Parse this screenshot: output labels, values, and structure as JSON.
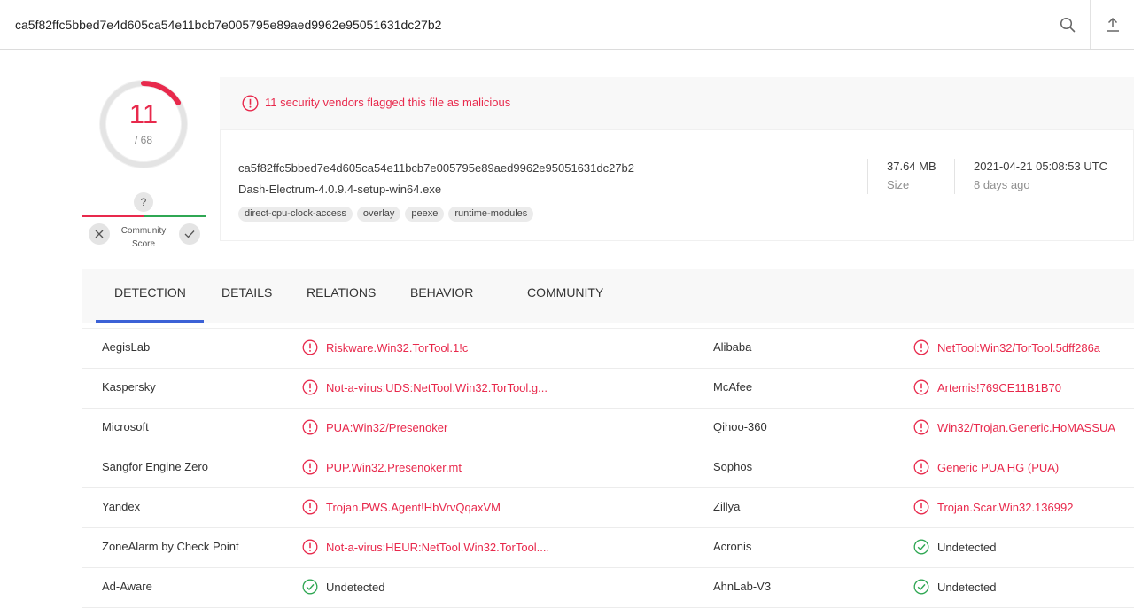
{
  "search": {
    "value": "ca5f82ffc5bbed7e4d605ca54e11bcb7e005795e89aed9962e95051631dc27b2"
  },
  "score": {
    "detections": 11,
    "total_label": "/ 68",
    "detections_text": "11",
    "fraction": 0.1618
  },
  "community": {
    "question": "?",
    "label_line1": "Community",
    "label_line2": "Score"
  },
  "banner": {
    "text": "11 security vendors flagged this file as malicious"
  },
  "file": {
    "hash": "ca5f82ffc5bbed7e4d605ca54e11bcb7e005795e89aed9962e95051631dc27b2",
    "name": "Dash-Electrum-4.0.9.4-setup-win64.exe",
    "tags": [
      "direct-cpu-clock-access",
      "overlay",
      "peexe",
      "runtime-modules"
    ],
    "size_value": "37.64 MB",
    "size_label": "Size",
    "date_value": "2021-04-21 05:08:53 UTC",
    "date_label": "8 days ago"
  },
  "tabs": [
    "DETECTION",
    "DETAILS",
    "RELATIONS",
    "BEHAVIOR",
    "COMMUNITY"
  ],
  "colors": {
    "malicious": "#e8294c",
    "clean": "#2fa753",
    "accent": "#3b61d6"
  },
  "detections": [
    {
      "left_vendor": "AegisLab",
      "left_result": "Riskware.Win32.TorTool.1!c",
      "left_status": "malicious",
      "right_vendor": "Alibaba",
      "right_result": "NetTool:Win32/TorTool.5dff286a",
      "right_status": "malicious"
    },
    {
      "left_vendor": "Kaspersky",
      "left_result": "Not-a-virus:UDS:NetTool.Win32.TorTool.g...",
      "left_status": "malicious",
      "right_vendor": "McAfee",
      "right_result": "Artemis!769CE11B1B70",
      "right_status": "malicious"
    },
    {
      "left_vendor": "Microsoft",
      "left_result": "PUA:Win32/Presenoker",
      "left_status": "malicious",
      "right_vendor": "Qihoo-360",
      "right_result": "Win32/Trojan.Generic.HoMASSUA",
      "right_status": "malicious"
    },
    {
      "left_vendor": "Sangfor Engine Zero",
      "left_result": "PUP.Win32.Presenoker.mt",
      "left_status": "malicious",
      "right_vendor": "Sophos",
      "right_result": "Generic PUA HG (PUA)",
      "right_status": "malicious"
    },
    {
      "left_vendor": "Yandex",
      "left_result": "Trojan.PWS.Agent!HbVrvQqaxVM",
      "left_status": "malicious",
      "right_vendor": "Zillya",
      "right_result": "Trojan.Scar.Win32.136992",
      "right_status": "malicious"
    },
    {
      "left_vendor": "ZoneAlarm by Check Point",
      "left_result": "Not-a-virus:HEUR:NetTool.Win32.TorTool....",
      "left_status": "malicious",
      "right_vendor": "Acronis",
      "right_result": "Undetected",
      "right_status": "clean"
    },
    {
      "left_vendor": "Ad-Aware",
      "left_result": "Undetected",
      "left_status": "clean",
      "right_vendor": "AhnLab-V3",
      "right_result": "Undetected",
      "right_status": "clean"
    }
  ]
}
